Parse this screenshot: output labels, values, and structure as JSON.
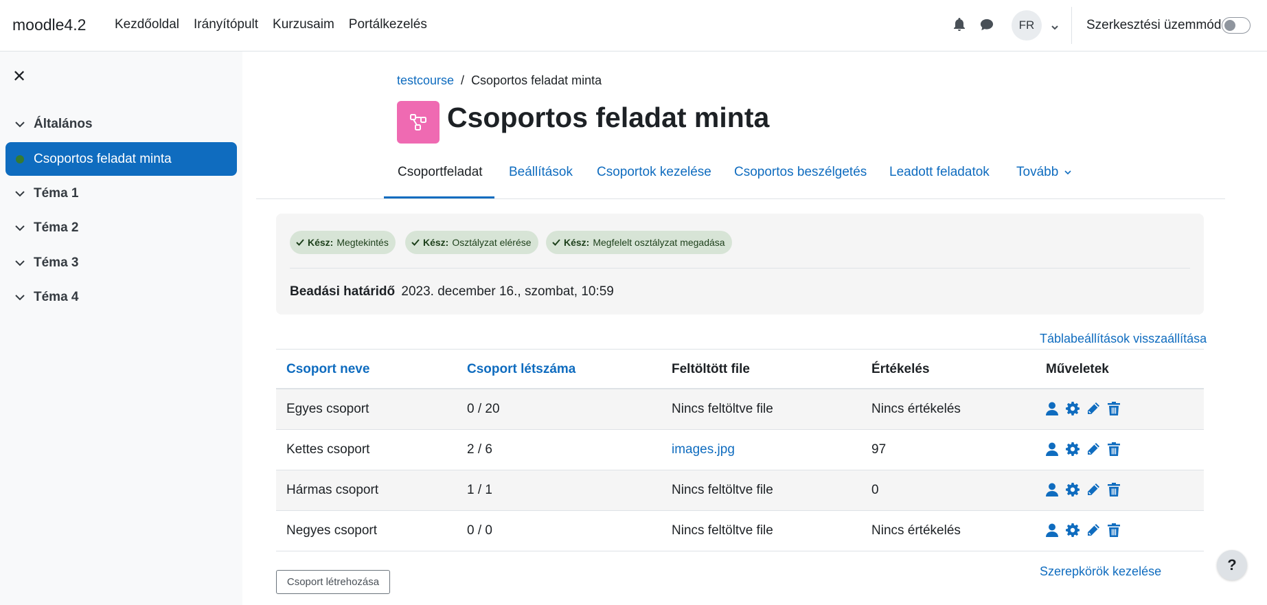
{
  "navbar": {
    "brand": "moodle4.2",
    "links": [
      "Kezdőoldal",
      "Irányítópult",
      "Kurzusaim",
      "Portálkezelés"
    ],
    "avatar_initials": "FR",
    "edit_mode_label": "Szerkesztési üzemmód",
    "edit_mode_on": false
  },
  "drawer": {
    "sections": [
      {
        "label": "Általános",
        "expanded": true
      },
      {
        "label": "Téma 1"
      },
      {
        "label": "Téma 2"
      },
      {
        "label": "Téma 3"
      },
      {
        "label": "Téma 4"
      }
    ],
    "active_item": "Csoportos feladat minta"
  },
  "breadcrumb": {
    "course": "testcourse",
    "separator": "/",
    "current": "Csoportos feladat minta"
  },
  "page": {
    "title": "Csoportos feladat minta",
    "icon_color": "#ef6ab2"
  },
  "tabs": [
    {
      "label": "Csoportfeladat",
      "active": true
    },
    {
      "label": "Beállítások"
    },
    {
      "label": "Csoportok kezelése"
    },
    {
      "label": "Csoportos beszélgetés"
    },
    {
      "label": "Leadott feladatok"
    },
    {
      "label": "Tovább"
    }
  ],
  "completion": [
    {
      "status": "Kész:",
      "label": "Megtekintés"
    },
    {
      "status": "Kész:",
      "label": "Osztályzat elérése"
    },
    {
      "status": "Kész:",
      "label": "Megfelelt osztályzat megadása"
    }
  ],
  "deadline": {
    "label": "Beadási határidő",
    "value": "2023. december 16., szombat, 10:59"
  },
  "reset_table_link": "Táblabeállítások visszaállítása",
  "table": {
    "headers": [
      "Csoport neve",
      "Csoport létszáma",
      "Feltöltött file",
      "Értékelés",
      "Műveletek"
    ],
    "rows": [
      {
        "name": "Egyes csoport",
        "size": "0 / 20",
        "file": "Nincs feltöltve file",
        "grade": "Nincs értékelés"
      },
      {
        "name": "Kettes csoport",
        "size": "2 / 6",
        "file": "images.jpg",
        "grade": "97"
      },
      {
        "name": "Hármas csoport",
        "size": "1 / 1",
        "file": "Nincs feltöltve file",
        "grade": "0"
      },
      {
        "name": "Negyes csoport",
        "size": "0 / 0",
        "file": "Nincs feltöltve file",
        "grade": "Nincs értékelés"
      }
    ]
  },
  "buttons": {
    "create_group": "Csoport létrehozása",
    "manage_roles": "Szerepkörök kezelése",
    "help": "?"
  },
  "colors": {
    "primary": "#0f6cbf",
    "success_dot": "#357a32",
    "badge_bg": "#d7e4d6"
  }
}
